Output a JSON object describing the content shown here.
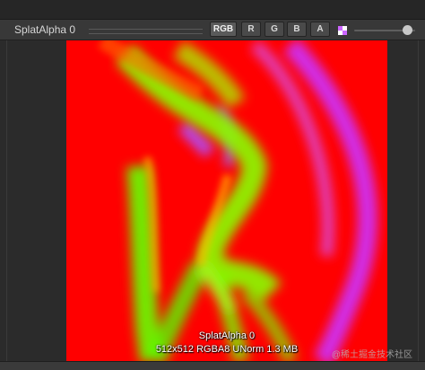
{
  "header": {
    "title": "SplatAlpha 0",
    "channels": [
      "RGB",
      "R",
      "G",
      "B",
      "A"
    ],
    "active_channel": "RGB"
  },
  "preview": {
    "name": "SplatAlpha 0",
    "info": "512x512  RGBA8 UNorm  1.3 MB",
    "mip_level": 1.0
  },
  "watermark": "@稀土掘金技术社区",
  "colors": {
    "red": "#ff0000",
    "green": "#44ff00",
    "magenta": "#cc33ff",
    "toolbar_bg": "#383838",
    "panel_bg": "#2b2b2b"
  },
  "icons": {
    "mip": "checker-icon",
    "slider": "mip-slider"
  }
}
